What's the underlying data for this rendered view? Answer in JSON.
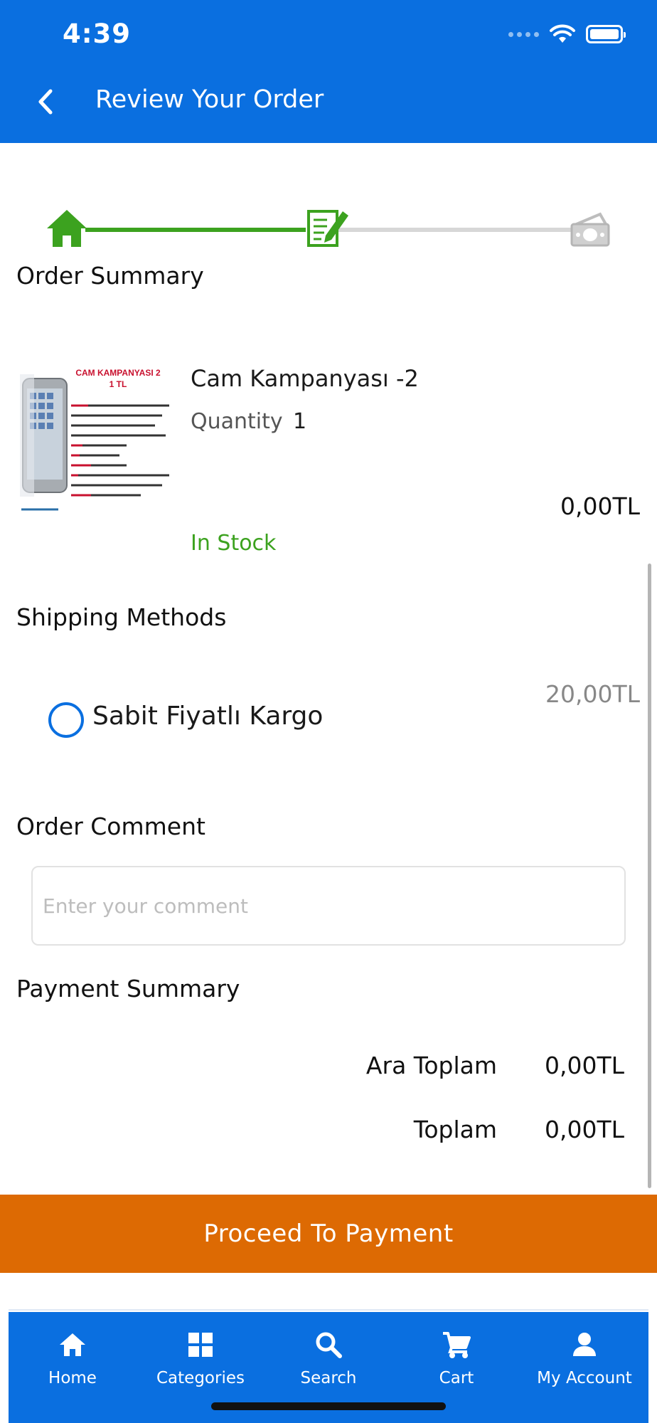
{
  "status_bar": {
    "time": "4:39"
  },
  "header": {
    "title": "Review Your Order"
  },
  "sections": {
    "order_summary": "Order Summary",
    "shipping_methods": "Shipping Methods",
    "order_comment": "Order Comment",
    "payment_summary": "Payment Summary"
  },
  "product": {
    "name": "Cam Kampanyası -2",
    "quantity_label": "Quantity",
    "quantity": "1",
    "price": "0,00TL",
    "stock": "In Stock",
    "image": {
      "headline": "CAM KAMPANYASI 2",
      "subhead": "1 TL"
    }
  },
  "shipping": {
    "method_name": "Sabit Fiyatlı Kargo",
    "method_price": "20,00TL"
  },
  "comment": {
    "placeholder": "Enter your comment"
  },
  "payment": {
    "subtotal_label": "Ara Toplam",
    "subtotal_value": "0,00TL",
    "total_label": "Toplam",
    "total_value": "0,00TL"
  },
  "proceed_button": "Proceed To Payment",
  "nav": [
    {
      "label": "Home",
      "icon": "home-icon"
    },
    {
      "label": "Categories",
      "icon": "grid-icon"
    },
    {
      "label": "Search",
      "icon": "search-icon"
    },
    {
      "label": "Cart",
      "icon": "cart-icon"
    },
    {
      "label": "My Account",
      "icon": "user-icon"
    }
  ],
  "colors": {
    "primary": "#0a6fe0",
    "accent_orange": "#dd6a03",
    "success_green": "#3ca21f"
  }
}
